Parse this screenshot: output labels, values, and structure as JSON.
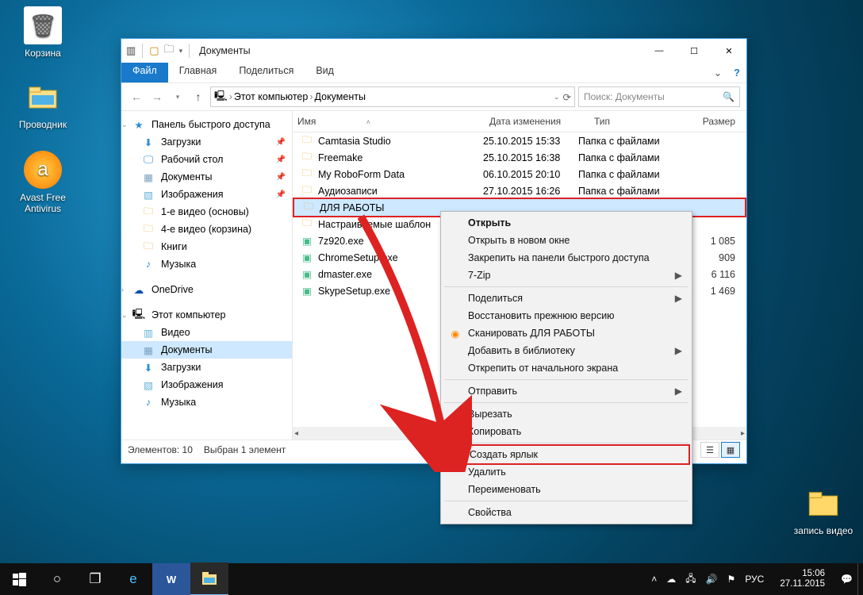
{
  "desktop_icons": {
    "recycle": "Корзина",
    "explorer": "Проводник",
    "avast": "Avast Free\nAntivirus",
    "video_folder": "запись видео"
  },
  "window": {
    "title": "Документы",
    "tabs": {
      "file": "Файл",
      "home": "Главная",
      "share": "Поделиться",
      "view": "Вид"
    },
    "breadcrumb": {
      "root": "Этот компьютер",
      "leaf": "Документы"
    },
    "search_ph": "Поиск: Документы",
    "columns": {
      "name": "Имя",
      "date": "Дата изменения",
      "type": "Тип",
      "size": "Размер"
    },
    "status": {
      "count": "Элементов: 10",
      "sel": "Выбран 1 элемент"
    }
  },
  "nav": {
    "quick": "Панель быстрого доступа",
    "quick_items": [
      "Загрузки",
      "Рабочий стол",
      "Документы",
      "Изображения",
      "1-е видео (основы)",
      "4-е видео (корзина)",
      "Книги",
      "Музыка"
    ],
    "onedrive": "OneDrive",
    "thispc": "Этот компьютер",
    "pc_items": [
      "Видео",
      "Документы",
      "Загрузки",
      "Изображения",
      "Музыка"
    ]
  },
  "files": [
    {
      "name": "Camtasia Studio",
      "date": "25.10.2015 15:33",
      "type": "Папка с файлами",
      "size": "",
      "kind": "folder"
    },
    {
      "name": "Freemake",
      "date": "25.10.2015 16:38",
      "type": "Папка с файлами",
      "size": "",
      "kind": "folder"
    },
    {
      "name": "My RoboForm Data",
      "date": "06.10.2015 20:10",
      "type": "Папка с файлами",
      "size": "",
      "kind": "folder"
    },
    {
      "name": "Аудиозаписи",
      "date": "27.10.2015 16:26",
      "type": "Папка с файлами",
      "size": "",
      "kind": "folder"
    },
    {
      "name": "ДЛЯ РАБОТЫ",
      "date": "",
      "type": "",
      "size": "",
      "kind": "folder",
      "sel": true
    },
    {
      "name": "Настраиваемые шаблон",
      "date": "",
      "type": "",
      "size": "",
      "kind": "folder"
    },
    {
      "name": "7z920.exe",
      "date": "",
      "type": "",
      "size": "1 085",
      "kind": "exe"
    },
    {
      "name": "ChromeSetup.exe",
      "date": "",
      "type": "",
      "size": "909",
      "kind": "exe"
    },
    {
      "name": "dmaster.exe",
      "date": "",
      "type": "",
      "size": "6 116",
      "kind": "exe"
    },
    {
      "name": "SkypeSetup.exe",
      "date": "",
      "type": "",
      "size": "1 469",
      "kind": "exe"
    }
  ],
  "ctx": {
    "open": "Открыть",
    "open_new": "Открыть в новом окне",
    "pin_quick": "Закрепить на панели быстрого доступа",
    "sevenzip": "7-Zip",
    "share": "Поделиться",
    "restore": "Восстановить прежнюю версию",
    "scan": "Сканировать ДЛЯ РАБОТЫ",
    "library": "Добавить в библиотеку",
    "unpin_start": "Открепить от начального экрана",
    "send": "Отправить",
    "cut": "Вырезать",
    "copy": "Копировать",
    "shortcut": "Создать ярлык",
    "delete": "Удалить",
    "rename": "Переименовать",
    "props": "Свойства"
  },
  "taskbar": {
    "lang": "РУС",
    "time": "15:06",
    "date": "27.11.2015"
  }
}
